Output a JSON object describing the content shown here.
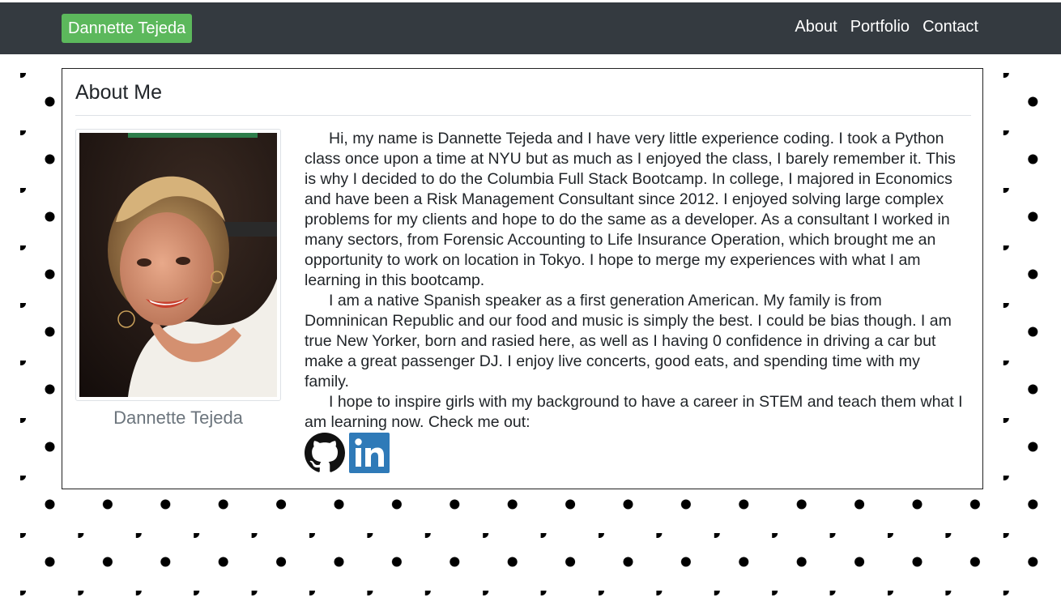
{
  "navbar": {
    "brand": "Dannette Tejeda",
    "brand_color": "#5cb85c",
    "background": "#343a40",
    "links": [
      "About",
      "Portfolio",
      "Contact"
    ]
  },
  "card": {
    "title": "About Me",
    "photo_caption": "Dannette Tejeda",
    "paragraphs": [
      "Hi, my name is Dannette Tejeda and I have very little experience coding. I took a Python class once upon a time at NYU but as much as I enjoyed the class, I barely remember it. This is why I decided to do the Columbia Full Stack Bootcamp. In college, I majored in Economics and have been a Risk Management Consultant since 2012. I enjoyed solving large complex problems for my clients and hope to do the same as a developer. As a consultant I worked in many sectors, from Forensic Accounting to Life Insurance Operation, which brought me an opportunity to work on location in Tokyo. I hope to merge my experiences with what I am learning in this bootcamp.",
      "I am a native Spanish speaker as a first generation American. My family is from Domninican Republic and our food and music is simply the best. I could be bias though. I am true New Yorker, born and rasied here, as well as I having 0 confidence in driving a car but make a great passenger DJ. I enjoy live concerts, good eats, and spending time with my family.",
      "I hope to inspire girls with my background to have a career in STEM and teach them what I am learning now. Check me out:"
    ],
    "social": [
      {
        "icon": "github-icon",
        "color": "#111111"
      },
      {
        "icon": "linkedin-icon",
        "color": "#2f7ab8"
      }
    ]
  }
}
